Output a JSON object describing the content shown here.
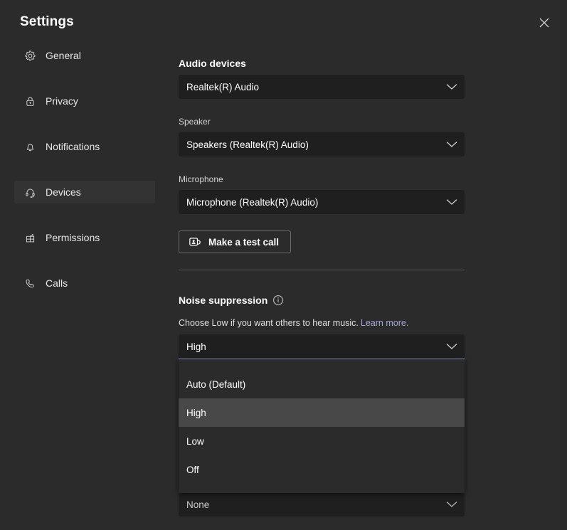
{
  "window": {
    "title": "Settings",
    "close_icon": "close-icon"
  },
  "sidebar": {
    "items": [
      {
        "label": "General",
        "icon": "gear-icon",
        "selected": false
      },
      {
        "label": "Privacy",
        "icon": "lock-icon",
        "selected": false
      },
      {
        "label": "Notifications",
        "icon": "bell-icon",
        "selected": false
      },
      {
        "label": "Devices",
        "icon": "headset-icon",
        "selected": true
      },
      {
        "label": "Permissions",
        "icon": "permissions-grid-icon",
        "selected": false
      },
      {
        "label": "Calls",
        "icon": "phone-icon",
        "selected": false
      }
    ]
  },
  "main": {
    "audio_devices": {
      "heading": "Audio devices",
      "value": "Realtek(R) Audio"
    },
    "speaker": {
      "label": "Speaker",
      "value": "Speakers (Realtek(R) Audio)"
    },
    "microphone": {
      "label": "Microphone",
      "value": "Microphone (Realtek(R) Audio)"
    },
    "test_call": {
      "label": "Make a test call",
      "icon": "video-call-icon"
    },
    "noise_suppression": {
      "heading": "Noise suppression",
      "info_icon": "info-circle-icon",
      "helper_text": "Choose Low if you want others to hear music.",
      "learn_more": "Learn more.",
      "selected_value": "High",
      "options": [
        {
          "label": "Auto (Default)",
          "highlighted": false
        },
        {
          "label": "High",
          "highlighted": true
        },
        {
          "label": "Low",
          "highlighted": false
        },
        {
          "label": "Off",
          "highlighted": false
        }
      ]
    },
    "bottom_combobox": {
      "value": "None"
    }
  },
  "colors": {
    "background": "#2b2b2b",
    "sidebar_selected": "#333333",
    "combobox_bg": "#1f1f1f",
    "focus_underline": "#9a9ad4",
    "link": "#a6a6d9",
    "option_highlight": "#484848",
    "divider": "#555555"
  }
}
